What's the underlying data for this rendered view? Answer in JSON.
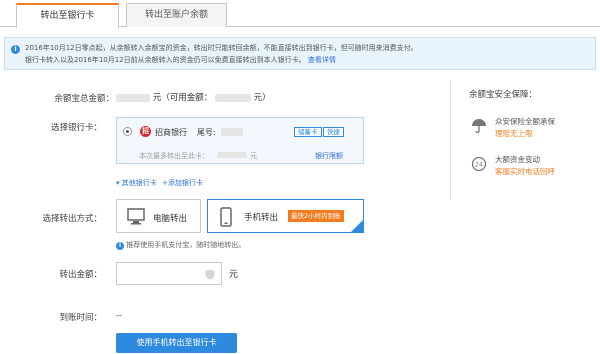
{
  "tabs": [
    {
      "label": "转出至银行卡",
      "active": true
    },
    {
      "label": "转出至账户余额",
      "active": false
    }
  ],
  "notice": {
    "line1": "2016年10月12日零点起，从余额转入余额宝的资金，转出时只能转回余额，不能直接转出到银行卡，但可随时用来消费支付。",
    "line2": "银行卡转入以及2016年10月12日前从余额转入的资金仍可以免费直接转出到本人银行卡。",
    "link": "查看详情"
  },
  "balance": {
    "label": "余额宝总金额：",
    "unit1": "元（可用金额：",
    "unit2": "元）"
  },
  "card_select": {
    "label": "选择银行卡：",
    "bank_name": "招商银行",
    "tail_label": "尾号:",
    "tag1": "储蓄卡",
    "tag2": "快捷",
    "max_text": "本次最多转出至此卡：",
    "max_unit": "元",
    "limit_link": "银行限额"
  },
  "other_links": {
    "other_cards": "其他银行卡",
    "add_card": "添加银行卡"
  },
  "method": {
    "label": "选择转出方式：",
    "pc": "电脑转出",
    "mobile": "手机转出",
    "badge": "最快2小时内到账",
    "hint": "推荐使用手机支付宝，随时随地转出。"
  },
  "amount": {
    "label": "转出金额：",
    "unit": "元",
    "placeholder": ""
  },
  "arrival": {
    "label": "到账时间：",
    "value": "--"
  },
  "submit_label": "使用手机转出至银行卡",
  "safety": {
    "title": "余额宝安全保障：",
    "items": [
      {
        "line1": "众安保险全额承保",
        "line2": "理赔无上限",
        "icon": "umbrella-icon"
      },
      {
        "line1": "大额资金变动",
        "line2": "客服实时电话回呼",
        "icon": "phone-24h-icon"
      }
    ]
  },
  "colors": {
    "accent": "#2e8ade",
    "orange": "#f47c20"
  }
}
